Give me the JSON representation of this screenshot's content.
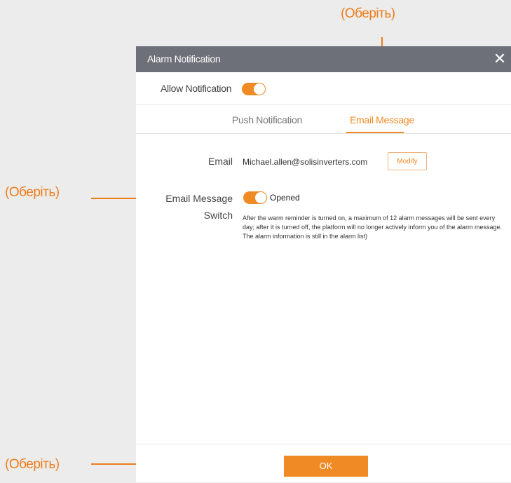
{
  "annotations": {
    "top": "(Оберіть)",
    "middle": "(Оберіть)",
    "bottom": "(Оберіть)"
  },
  "dialog": {
    "title": "Alarm Notification",
    "close_icon": "close-icon"
  },
  "allow": {
    "label": "Allow Notification",
    "enabled": true
  },
  "tabs": [
    {
      "label": "Push Notification",
      "active": false
    },
    {
      "label": "Email Message",
      "active": true
    }
  ],
  "email": {
    "label": "Email",
    "value": "Michael.allen@solisinverters.com",
    "modify_label": "Modify"
  },
  "email_switch": {
    "label_line1": "Email Message",
    "label_line2": "Switch",
    "status": "Opened",
    "enabled": true,
    "description": "After the warm reminder is turned on, a maximum of 12 alarm messages will be sent every day; after it is turned off, the platform will no longer actively inform you of the alarm message. The alarm information is still in the alarm list)"
  },
  "footer": {
    "ok_label": "OK"
  },
  "colors": {
    "accent": "#f08a24",
    "titlebar": "#6d7078",
    "backdrop": "#ececec"
  }
}
